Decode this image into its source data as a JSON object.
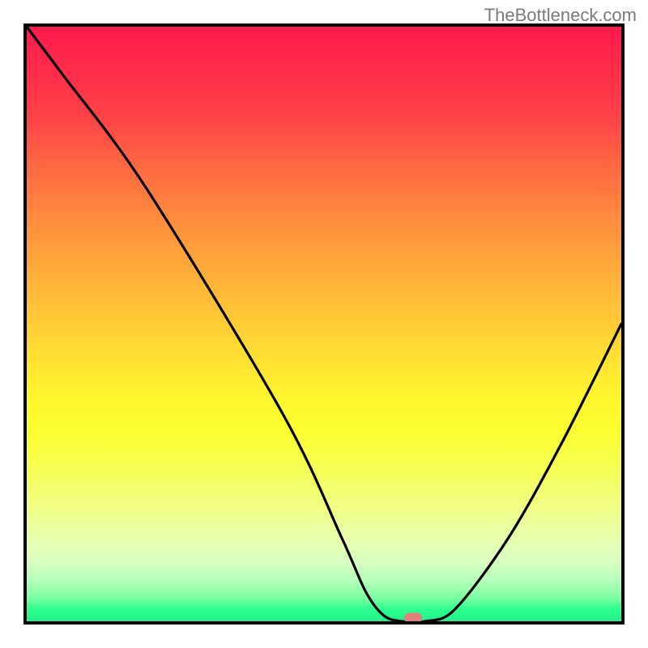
{
  "watermark": "TheBottleneck.com",
  "chart_data": {
    "type": "line",
    "title": "",
    "xlabel": "",
    "ylabel": "",
    "xlim": [
      0,
      100
    ],
    "ylim": [
      0,
      100
    ],
    "grid": false,
    "series": [
      {
        "name": "bottleneck-curve",
        "x": [
          0,
          6,
          20,
          43,
          53,
          57,
          60,
          63,
          67,
          72,
          81,
          90,
          100
        ],
        "values": [
          100,
          92,
          73,
          35,
          14,
          5,
          1,
          0,
          0,
          2,
          14,
          30,
          50
        ]
      }
    ],
    "marker": {
      "x": 65,
      "y": 0.5,
      "color": "#e37f7a"
    },
    "background_gradient": {
      "from": "#ff1a4c",
      "to": "#22f08c"
    }
  }
}
